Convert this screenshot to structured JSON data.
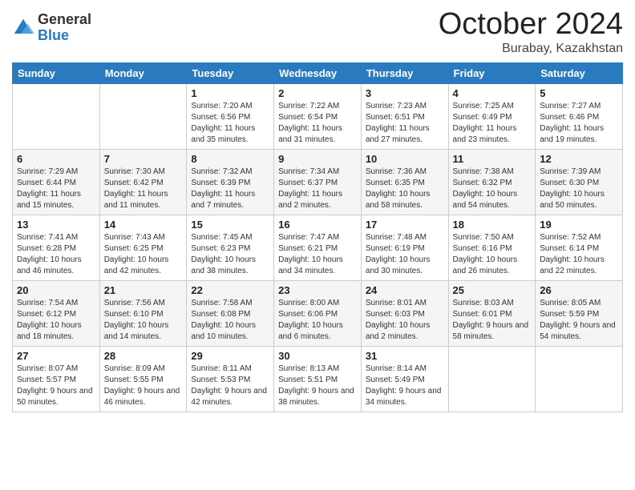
{
  "logo": {
    "general": "General",
    "blue": "Blue"
  },
  "title": {
    "month": "October 2024",
    "location": "Burabay, Kazakhstan"
  },
  "weekdays": [
    "Sunday",
    "Monday",
    "Tuesday",
    "Wednesday",
    "Thursday",
    "Friday",
    "Saturday"
  ],
  "weeks": [
    [
      {
        "day": "",
        "info": ""
      },
      {
        "day": "",
        "info": ""
      },
      {
        "day": "1",
        "sunrise": "Sunrise: 7:20 AM",
        "sunset": "Sunset: 6:56 PM",
        "daylight": "Daylight: 11 hours and 35 minutes."
      },
      {
        "day": "2",
        "sunrise": "Sunrise: 7:22 AM",
        "sunset": "Sunset: 6:54 PM",
        "daylight": "Daylight: 11 hours and 31 minutes."
      },
      {
        "day": "3",
        "sunrise": "Sunrise: 7:23 AM",
        "sunset": "Sunset: 6:51 PM",
        "daylight": "Daylight: 11 hours and 27 minutes."
      },
      {
        "day": "4",
        "sunrise": "Sunrise: 7:25 AM",
        "sunset": "Sunset: 6:49 PM",
        "daylight": "Daylight: 11 hours and 23 minutes."
      },
      {
        "day": "5",
        "sunrise": "Sunrise: 7:27 AM",
        "sunset": "Sunset: 6:46 PM",
        "daylight": "Daylight: 11 hours and 19 minutes."
      }
    ],
    [
      {
        "day": "6",
        "sunrise": "Sunrise: 7:29 AM",
        "sunset": "Sunset: 6:44 PM",
        "daylight": "Daylight: 11 hours and 15 minutes."
      },
      {
        "day": "7",
        "sunrise": "Sunrise: 7:30 AM",
        "sunset": "Sunset: 6:42 PM",
        "daylight": "Daylight: 11 hours and 11 minutes."
      },
      {
        "day": "8",
        "sunrise": "Sunrise: 7:32 AM",
        "sunset": "Sunset: 6:39 PM",
        "daylight": "Daylight: 11 hours and 7 minutes."
      },
      {
        "day": "9",
        "sunrise": "Sunrise: 7:34 AM",
        "sunset": "Sunset: 6:37 PM",
        "daylight": "Daylight: 11 hours and 2 minutes."
      },
      {
        "day": "10",
        "sunrise": "Sunrise: 7:36 AM",
        "sunset": "Sunset: 6:35 PM",
        "daylight": "Daylight: 10 hours and 58 minutes."
      },
      {
        "day": "11",
        "sunrise": "Sunrise: 7:38 AM",
        "sunset": "Sunset: 6:32 PM",
        "daylight": "Daylight: 10 hours and 54 minutes."
      },
      {
        "day": "12",
        "sunrise": "Sunrise: 7:39 AM",
        "sunset": "Sunset: 6:30 PM",
        "daylight": "Daylight: 10 hours and 50 minutes."
      }
    ],
    [
      {
        "day": "13",
        "sunrise": "Sunrise: 7:41 AM",
        "sunset": "Sunset: 6:28 PM",
        "daylight": "Daylight: 10 hours and 46 minutes."
      },
      {
        "day": "14",
        "sunrise": "Sunrise: 7:43 AM",
        "sunset": "Sunset: 6:25 PM",
        "daylight": "Daylight: 10 hours and 42 minutes."
      },
      {
        "day": "15",
        "sunrise": "Sunrise: 7:45 AM",
        "sunset": "Sunset: 6:23 PM",
        "daylight": "Daylight: 10 hours and 38 minutes."
      },
      {
        "day": "16",
        "sunrise": "Sunrise: 7:47 AM",
        "sunset": "Sunset: 6:21 PM",
        "daylight": "Daylight: 10 hours and 34 minutes."
      },
      {
        "day": "17",
        "sunrise": "Sunrise: 7:48 AM",
        "sunset": "Sunset: 6:19 PM",
        "daylight": "Daylight: 10 hours and 30 minutes."
      },
      {
        "day": "18",
        "sunrise": "Sunrise: 7:50 AM",
        "sunset": "Sunset: 6:16 PM",
        "daylight": "Daylight: 10 hours and 26 minutes."
      },
      {
        "day": "19",
        "sunrise": "Sunrise: 7:52 AM",
        "sunset": "Sunset: 6:14 PM",
        "daylight": "Daylight: 10 hours and 22 minutes."
      }
    ],
    [
      {
        "day": "20",
        "sunrise": "Sunrise: 7:54 AM",
        "sunset": "Sunset: 6:12 PM",
        "daylight": "Daylight: 10 hours and 18 minutes."
      },
      {
        "day": "21",
        "sunrise": "Sunrise: 7:56 AM",
        "sunset": "Sunset: 6:10 PM",
        "daylight": "Daylight: 10 hours and 14 minutes."
      },
      {
        "day": "22",
        "sunrise": "Sunrise: 7:58 AM",
        "sunset": "Sunset: 6:08 PM",
        "daylight": "Daylight: 10 hours and 10 minutes."
      },
      {
        "day": "23",
        "sunrise": "Sunrise: 8:00 AM",
        "sunset": "Sunset: 6:06 PM",
        "daylight": "Daylight: 10 hours and 6 minutes."
      },
      {
        "day": "24",
        "sunrise": "Sunrise: 8:01 AM",
        "sunset": "Sunset: 6:03 PM",
        "daylight": "Daylight: 10 hours and 2 minutes."
      },
      {
        "day": "25",
        "sunrise": "Sunrise: 8:03 AM",
        "sunset": "Sunset: 6:01 PM",
        "daylight": "Daylight: 9 hours and 58 minutes."
      },
      {
        "day": "26",
        "sunrise": "Sunrise: 8:05 AM",
        "sunset": "Sunset: 5:59 PM",
        "daylight": "Daylight: 9 hours and 54 minutes."
      }
    ],
    [
      {
        "day": "27",
        "sunrise": "Sunrise: 8:07 AM",
        "sunset": "Sunset: 5:57 PM",
        "daylight": "Daylight: 9 hours and 50 minutes."
      },
      {
        "day": "28",
        "sunrise": "Sunrise: 8:09 AM",
        "sunset": "Sunset: 5:55 PM",
        "daylight": "Daylight: 9 hours and 46 minutes."
      },
      {
        "day": "29",
        "sunrise": "Sunrise: 8:11 AM",
        "sunset": "Sunset: 5:53 PM",
        "daylight": "Daylight: 9 hours and 42 minutes."
      },
      {
        "day": "30",
        "sunrise": "Sunrise: 8:13 AM",
        "sunset": "Sunset: 5:51 PM",
        "daylight": "Daylight: 9 hours and 38 minutes."
      },
      {
        "day": "31",
        "sunrise": "Sunrise: 8:14 AM",
        "sunset": "Sunset: 5:49 PM",
        "daylight": "Daylight: 9 hours and 34 minutes."
      },
      {
        "day": "",
        "info": ""
      },
      {
        "day": "",
        "info": ""
      }
    ]
  ]
}
